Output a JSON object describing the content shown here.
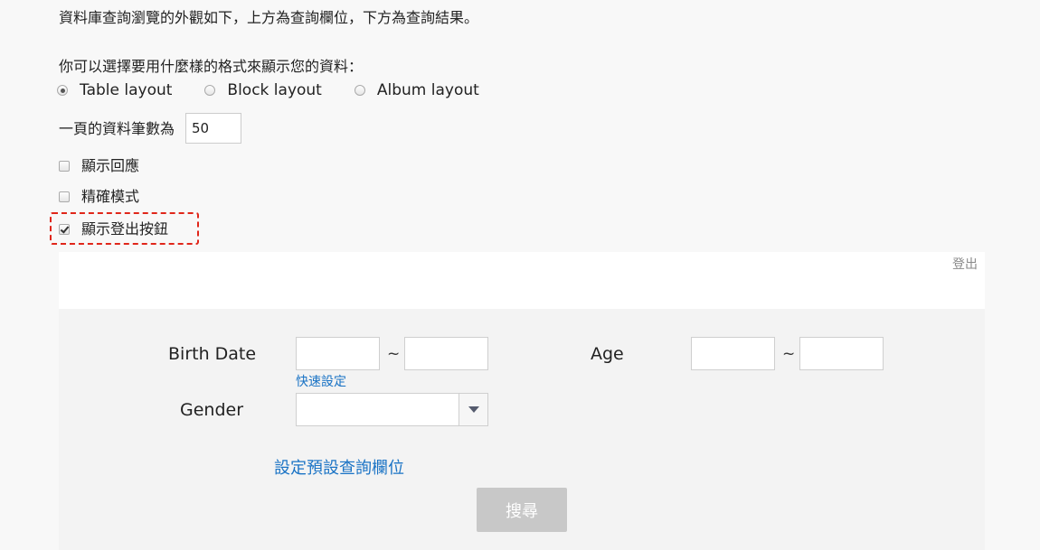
{
  "intro_text": "資料庫查詢瀏覽的外觀如下，上方為查詢欄位，下方為查詢結果。",
  "format_prompt": "你可以選擇要用什麼樣的格式來顯示您的資料：",
  "layouts": [
    {
      "label": "Table layout",
      "selected": true
    },
    {
      "label": "Block layout",
      "selected": false
    },
    {
      "label": "Album layout",
      "selected": false
    }
  ],
  "per_page": {
    "label": "一頁的資料筆數為",
    "value": "50"
  },
  "options": {
    "show_reply": {
      "label": "顯示回應",
      "checked": false
    },
    "exact_mode": {
      "label": "精確模式",
      "checked": false
    },
    "show_logout": {
      "label": "顯示登出按鈕",
      "checked": true
    }
  },
  "highlight_color": "#e0261a",
  "logout_label": "登出",
  "form": {
    "birth_date_label": "Birth Date",
    "age_label": "Age",
    "gender_label": "Gender",
    "tilde": "~",
    "quick_setting": "快速設定",
    "gender_value": ""
  },
  "preset_link": "設定預設查詢欄位",
  "search_button": "搜尋",
  "link_color": "#1a73c5"
}
